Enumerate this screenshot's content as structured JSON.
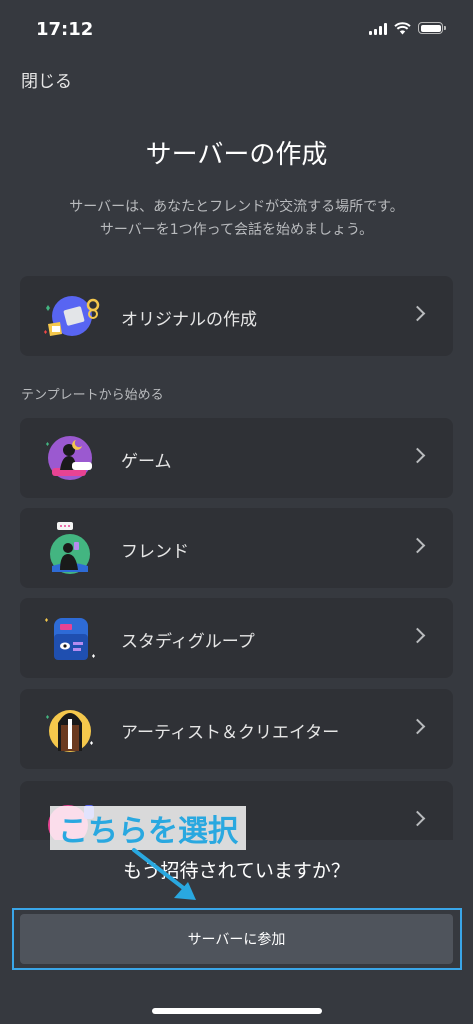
{
  "status_bar": {
    "time": "17:12"
  },
  "header": {
    "close_label": "閉じる",
    "title": "サーバーの作成",
    "subtitle_line1": "サーバーは、あなたとフレンドが交流する場所です。",
    "subtitle_line2": "サーバーを1つ作って会話を始めましょう。"
  },
  "original": {
    "label": "オリジナルの作成",
    "icon": "create-server-icon"
  },
  "templates": {
    "section_label": "テンプレートから始める",
    "items": [
      {
        "label": "ゲーム",
        "icon": "gaming-icon"
      },
      {
        "label": "フレンド",
        "icon": "friends-icon"
      },
      {
        "label": "スタディグループ",
        "icon": "study-group-icon"
      },
      {
        "label": "アーティスト＆クリエイター",
        "icon": "artists-icon"
      },
      {
        "label": "",
        "icon": "club-icon"
      }
    ]
  },
  "join": {
    "prompt": "もう招待されていますか？",
    "button_label": "サーバーに参加"
  },
  "annotation": {
    "callout_text": "こちらを選択",
    "color": "#29a8e0"
  },
  "colors": {
    "background": "#36393f",
    "card": "#2f3136",
    "button": "#4f545c"
  }
}
